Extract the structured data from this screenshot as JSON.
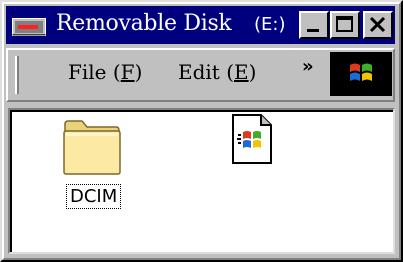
{
  "window": {
    "title": "Removable Disk",
    "drive_letter": "(E:)",
    "title_bar_color": "#00007f",
    "face_color": "#c0c0c0",
    "icon": "drive-icon",
    "controls": {
      "minimize_icon": "minimize-icon",
      "maximize_icon": "maximize-icon",
      "close_icon": "close-icon"
    }
  },
  "menu": {
    "file": {
      "text": "File (",
      "accel": "F",
      "end": ")"
    },
    "edit": {
      "text": "Edit (",
      "accel": "E",
      "end": ")"
    },
    "more": "»",
    "throbber_icon": "windows-logo-icon"
  },
  "items": [
    {
      "name": "DCIM",
      "icon": "folder-icon",
      "selected": true
    },
    {
      "name": "",
      "icon": "windows-file-icon",
      "selected": false
    }
  ]
}
